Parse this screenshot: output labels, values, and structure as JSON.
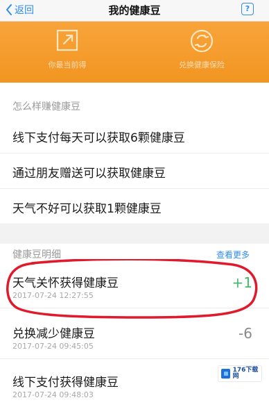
{
  "nav": {
    "back_label": "返回",
    "title": "我的健康豆",
    "help_label": "?"
  },
  "banner": {
    "left_label": "你最当前得",
    "right_label": "兑换健康保险"
  },
  "earn": {
    "header": "怎么样赚健康豆",
    "items": [
      "线下支付每天可以获取6颗健康豆",
      "通过朋友赠送可以获取健康豆",
      "天气不好可以获取1颗健康豆"
    ]
  },
  "details": {
    "header": "健康豆明细",
    "more_label": "查看更多",
    "rows": [
      {
        "title": "天气关怀获得健康豆",
        "time": "2017-07-24 12:27:55",
        "amount": "+1"
      },
      {
        "title": "兑换减少健康豆",
        "time": "2017-07-24 09:45:05",
        "amount": "-6"
      },
      {
        "title": "线下支付获得健康豆",
        "time": "2017-07-24 09:48:03",
        "amount": ""
      }
    ]
  },
  "watermark": {
    "line1": "176下载网",
    "line2": ""
  },
  "colors": {
    "accent_blue": "#2d8cf0",
    "banner_orange": "#f29522",
    "positive_green": "#44b96a",
    "annotation_red": "#e0192b"
  }
}
